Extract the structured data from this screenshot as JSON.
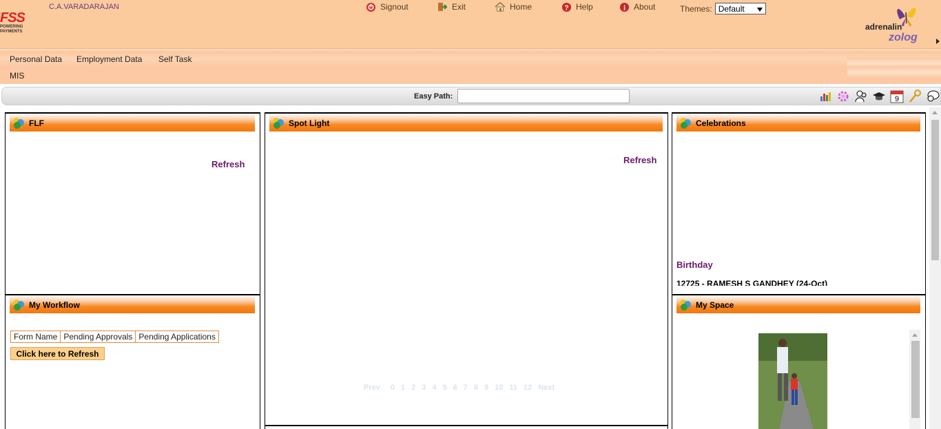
{
  "header": {
    "logo": {
      "brand": "FSS",
      "tagline_1": "POWERING",
      "tagline_2": "PAYMENTS"
    },
    "username": "C.A.VARADARAJAN",
    "menu": {
      "signout": "Signout",
      "exit": "Exit",
      "home": "Home",
      "help": "Help",
      "about": "About"
    },
    "themes": {
      "label": "Themes:",
      "selected": "Default"
    },
    "product": {
      "adrenalin": "adrenalin",
      "zolog": "zolog"
    }
  },
  "nav": {
    "items": [
      "Personal Data",
      "Employment Data",
      "Self Task",
      "MIS"
    ]
  },
  "easy_path": {
    "label": "Easy Path:",
    "value": ""
  },
  "toolbar_icons": [
    "chart-icon",
    "gear-icon",
    "people-icon",
    "hat-icon",
    "calendar-icon",
    "key-icon",
    "chat-icon"
  ],
  "calendar_day": "9",
  "panels": {
    "flf": {
      "title": "FLF",
      "refresh": "Refresh"
    },
    "spotlight": {
      "title": "Spot Light",
      "refresh": "Refresh",
      "pager": [
        "Prev",
        "0",
        "1",
        "2",
        "3",
        "4",
        "5",
        "6",
        "7",
        "8",
        "9",
        "10",
        "11",
        "12",
        "Next"
      ]
    },
    "celebrations": {
      "title": "Celebrations",
      "section": "Birthday",
      "entry": "12725 - RAMESH S GANDHEY (24-Oct)"
    },
    "workflow": {
      "title": "My Workflow",
      "columns": [
        "Form Name",
        "Pending Approvals",
        "Pending Applications"
      ],
      "refresh_button": "Click here to Refresh"
    },
    "myspace": {
      "title": "My Space"
    }
  },
  "colors": {
    "header_bg": "#fbcb9e",
    "panel_header": "#f27812",
    "refresh_text": "#6b1a6b",
    "logo_red": "#e2231a"
  }
}
